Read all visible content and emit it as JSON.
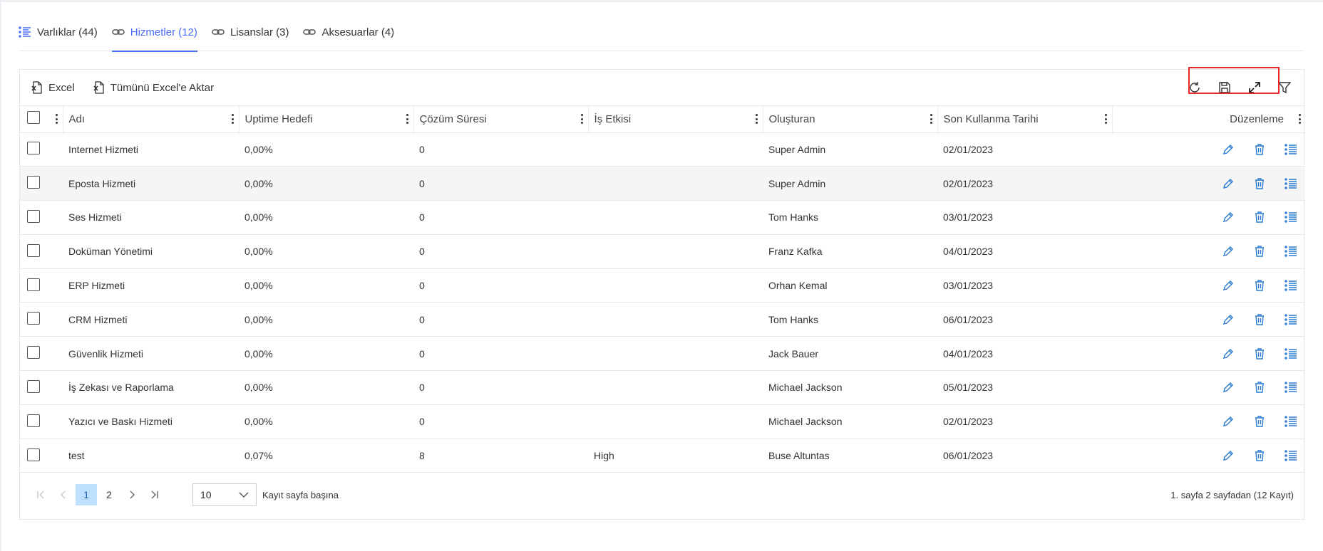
{
  "tabs": [
    {
      "label": "Varlıklar (44)",
      "icon": "list-icon",
      "active": false
    },
    {
      "label": "Hizmetler (12)",
      "icon": "link-icon",
      "active": true
    },
    {
      "label": "Lisanslar (3)",
      "icon": "link-icon",
      "active": false
    },
    {
      "label": "Aksesuarlar (4)",
      "icon": "link-icon",
      "active": false
    }
  ],
  "toolbar": {
    "excel_label": "Excel",
    "export_all_label": "Tümünü Excel'e Aktar"
  },
  "columns": [
    "Adı",
    "Uptime Hedefi",
    "Çözüm Süresi",
    "İş Etkisi",
    "Oluşturan",
    "Son Kullanma Tarihi",
    "Düzenleme"
  ],
  "rows": [
    {
      "name": "Internet Hizmeti",
      "uptime": "0,00%",
      "solution": "0",
      "impact": "",
      "creator": "Super Admin",
      "expiry": "02/01/2023"
    },
    {
      "name": "Eposta Hizmeti",
      "uptime": "0,00%",
      "solution": "0",
      "impact": "",
      "creator": "Super Admin",
      "expiry": "02/01/2023"
    },
    {
      "name": "Ses Hizmeti",
      "uptime": "0,00%",
      "solution": "0",
      "impact": "",
      "creator": "Tom Hanks",
      "expiry": "03/01/2023"
    },
    {
      "name": "Doküman Yönetimi",
      "uptime": "0,00%",
      "solution": "0",
      "impact": "",
      "creator": "Franz Kafka",
      "expiry": "04/01/2023"
    },
    {
      "name": "ERP Hizmeti",
      "uptime": "0,00%",
      "solution": "0",
      "impact": "",
      "creator": "Orhan Kemal",
      "expiry": "03/01/2023"
    },
    {
      "name": "CRM Hizmeti",
      "uptime": "0,00%",
      "solution": "0",
      "impact": "",
      "creator": "Tom Hanks",
      "expiry": "06/01/2023"
    },
    {
      "name": "Güvenlik Hizmeti",
      "uptime": "0,00%",
      "solution": "0",
      "impact": "",
      "creator": "Jack Bauer",
      "expiry": "04/01/2023"
    },
    {
      "name": "İş Zekası ve Raporlama",
      "uptime": "0,00%",
      "solution": "0",
      "impact": "",
      "creator": "Michael Jackson",
      "expiry": "05/01/2023"
    },
    {
      "name": "Yazıcı ve Baskı Hizmeti",
      "uptime": "0,00%",
      "solution": "0",
      "impact": "",
      "creator": "Michael Jackson",
      "expiry": "02/01/2023"
    },
    {
      "name": "test",
      "uptime": "0,07%",
      "solution": "8",
      "impact": "High",
      "creator": "Buse Altuntas",
      "expiry": "06/01/2023"
    }
  ],
  "pagination": {
    "pages": [
      "1",
      "2"
    ],
    "current": "1",
    "page_size": "10",
    "page_size_label": "Kayıt sayfa başına",
    "info": "1. sayfa 2 sayfadan (12 Kayıt)"
  },
  "colors": {
    "accent": "#4a6cf7",
    "action_icon": "#2a7bd0",
    "highlight": "#e5282c",
    "current_page_bg": "#bfe0ff"
  }
}
